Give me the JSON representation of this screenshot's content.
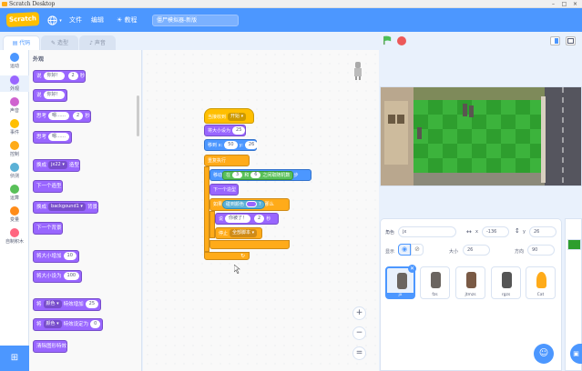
{
  "window": {
    "title": "Scratch Desktop",
    "controls": [
      "–",
      "□",
      "×"
    ]
  },
  "menubar": {
    "logo": "Scratch",
    "language_icon": "globe-icon",
    "file": "文件",
    "edit": "编辑",
    "tutorials": "教程",
    "project_title": "僵尸模拟器-新版"
  },
  "tabs": {
    "code": "代码",
    "costumes": "造型",
    "sounds": "声音"
  },
  "categories": [
    {
      "label": "运动",
      "color": "#4c97ff"
    },
    {
      "label": "外观",
      "color": "#9966ff"
    },
    {
      "label": "声音",
      "color": "#cf63cf"
    },
    {
      "label": "事件",
      "color": "#ffbf00"
    },
    {
      "label": "控制",
      "color": "#ffab19"
    },
    {
      "label": "侦测",
      "color": "#5cb1d6"
    },
    {
      "label": "运算",
      "color": "#59c059"
    },
    {
      "label": "变量",
      "color": "#ff8c1a"
    },
    {
      "label": "自制积木",
      "color": "#ff6680"
    }
  ],
  "palette": {
    "section": "外观",
    "blocks": {
      "b1": {
        "a": "说",
        "s1": "你好！",
        "s2": "2",
        "b": "秒"
      },
      "b2": {
        "a": "说",
        "s1": "你好！"
      },
      "b3": {
        "a": "思考",
        "s1": "嗯……",
        "s2": "2",
        "b": "秒"
      },
      "b4": {
        "a": "思考",
        "s1": "嗯……"
      },
      "b5": {
        "a": "换成",
        "d1": "jx22 ▾",
        "b": "造型"
      },
      "b6": {
        "a": "下一个造型"
      },
      "b7": {
        "a": "换成",
        "d1": "backgound1 ▾",
        "b": "背景"
      },
      "b8": {
        "a": "下一个背景"
      },
      "b9": {
        "a": "将大小增加",
        "s1": "10"
      },
      "b10": {
        "a": "将大小设为",
        "s1": "100"
      },
      "b11": {
        "a": "将",
        "d1": "颜色 ▾",
        "b": "特效增加",
        "s1": "25"
      },
      "b12": {
        "a": "将",
        "d1": "颜色 ▾",
        "b": "特效设定为",
        "s1": "0"
      },
      "b13": {
        "a": "清除图形特效"
      }
    }
  },
  "script": {
    "hat": {
      "a": "当接收到",
      "d1": "开始 ▾"
    },
    "size": {
      "a": "将大小设为",
      "s1": "25"
    },
    "goto": {
      "a": "移到 x:",
      "s1": "50",
      "b": "y:",
      "s2": "26"
    },
    "forever": "重复执行",
    "move": {
      "a": "移动",
      "pre": "在",
      "s1": "3",
      "and": "和",
      "s2": "6",
      "mid": "之间取随机数",
      "b": "步"
    },
    "next": "下一个造型",
    "if": {
      "a": "如果",
      "cond": "碰到颜色",
      "q": "?",
      "then": "那么"
    },
    "say": {
      "a": "说",
      "s1": "你被了！",
      "s2": "2",
      "b": "秒"
    },
    "stop": {
      "a": "停止",
      "d1": "全部脚本 ▾"
    }
  },
  "zoom": {
    "in": "+",
    "out": "−",
    "reset": "="
  },
  "stage_controls": {
    "flag": "green-flag-icon",
    "stop": "stop-icon"
  },
  "sprite_info": {
    "sprite_label": "角色",
    "sprite_name": "jx",
    "x_label": "x",
    "x": "-136",
    "y_label": "y",
    "y": "26",
    "show_label": "显示",
    "size_label": "大小",
    "size": "26",
    "dir_label": "方向",
    "dir": "90"
  },
  "sprites": [
    {
      "name": "jx",
      "selected": true
    },
    {
      "name": "fzs",
      "selected": false
    },
    {
      "name": "jtmzs",
      "selected": false
    },
    {
      "name": "rgzs",
      "selected": false
    },
    {
      "name": "Cat",
      "selected": false
    }
  ],
  "colors": {
    "accent": "#4c97ff",
    "looks": "#9966ff",
    "control": "#ffab19",
    "events": "#ffbf00",
    "operators": "#59c059",
    "lawn": "#2e9e2e"
  }
}
